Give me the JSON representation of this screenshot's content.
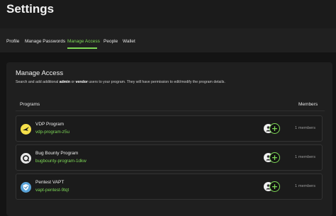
{
  "header": {
    "title": "Settings"
  },
  "tabs": [
    {
      "label": "Profile",
      "active": false
    },
    {
      "label": "Manage Passwords",
      "active": false
    },
    {
      "label": "Manage Access",
      "active": true
    },
    {
      "label": "People",
      "active": false
    },
    {
      "label": "Wallet",
      "active": false
    }
  ],
  "panel": {
    "title": "Manage Access",
    "desc_prefix": "Search and add additional ",
    "desc_admin": "admin",
    "desc_or": " or ",
    "desc_vendor": "vendor",
    "desc_suffix": " users to your program. They will have permission to edit/modify the program details.",
    "col_programs": "Programs",
    "col_members": "Members"
  },
  "programs": [
    {
      "name": "VDP Program",
      "slug": "vdp-program-z5u",
      "members": "1 members",
      "icon": "bird-icon"
    },
    {
      "name": "Bug Bounty Program",
      "slug": "bugbounty-program-1dkw",
      "members": "1 members",
      "icon": "bug-icon"
    },
    {
      "name": "Pentest VAPT",
      "slug": "vapt-pentest-9tqt",
      "members": "1 members",
      "icon": "shield-icon"
    }
  ],
  "colors": {
    "accent": "#7ed957",
    "background": "#141414",
    "panel": "#1f1f1f"
  }
}
